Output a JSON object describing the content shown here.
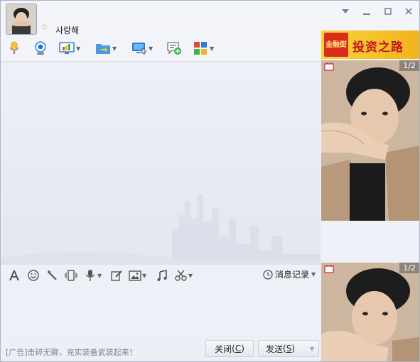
{
  "header": {
    "username": "사랑해",
    "window_controls": [
      "chevron-down-icon",
      "minimize-icon",
      "maximize-icon",
      "close-icon"
    ]
  },
  "toolbar": {
    "items": [
      "microphone-icon",
      "webcam-icon",
      "screen-share-icon",
      "file-transfer-icon",
      "remote-desktop-icon",
      "chat-add-icon",
      "apps-icon"
    ]
  },
  "input_toolbar": {
    "items": [
      "font-icon",
      "emoji-icon",
      "magic-wand-icon",
      "shake-icon",
      "voice-icon",
      "edit-icon",
      "image-icon",
      "music-icon",
      "scissors-icon"
    ],
    "history_label": "消息记录"
  },
  "footer": {
    "ad_text": "[广告]击碎无聊，充实装备武装起来！",
    "close_label": "关闭",
    "close_key": "C",
    "send_label": "发送",
    "send_key": "S"
  },
  "side": {
    "banner_logo": "金融街",
    "banner_text": "投资之路",
    "video_counter_1": "1/2",
    "video_counter_2": "1/2"
  },
  "colors": {
    "accent": "#2a7fd4",
    "banner": "#f3b31c",
    "banner_text": "#c1171f"
  }
}
